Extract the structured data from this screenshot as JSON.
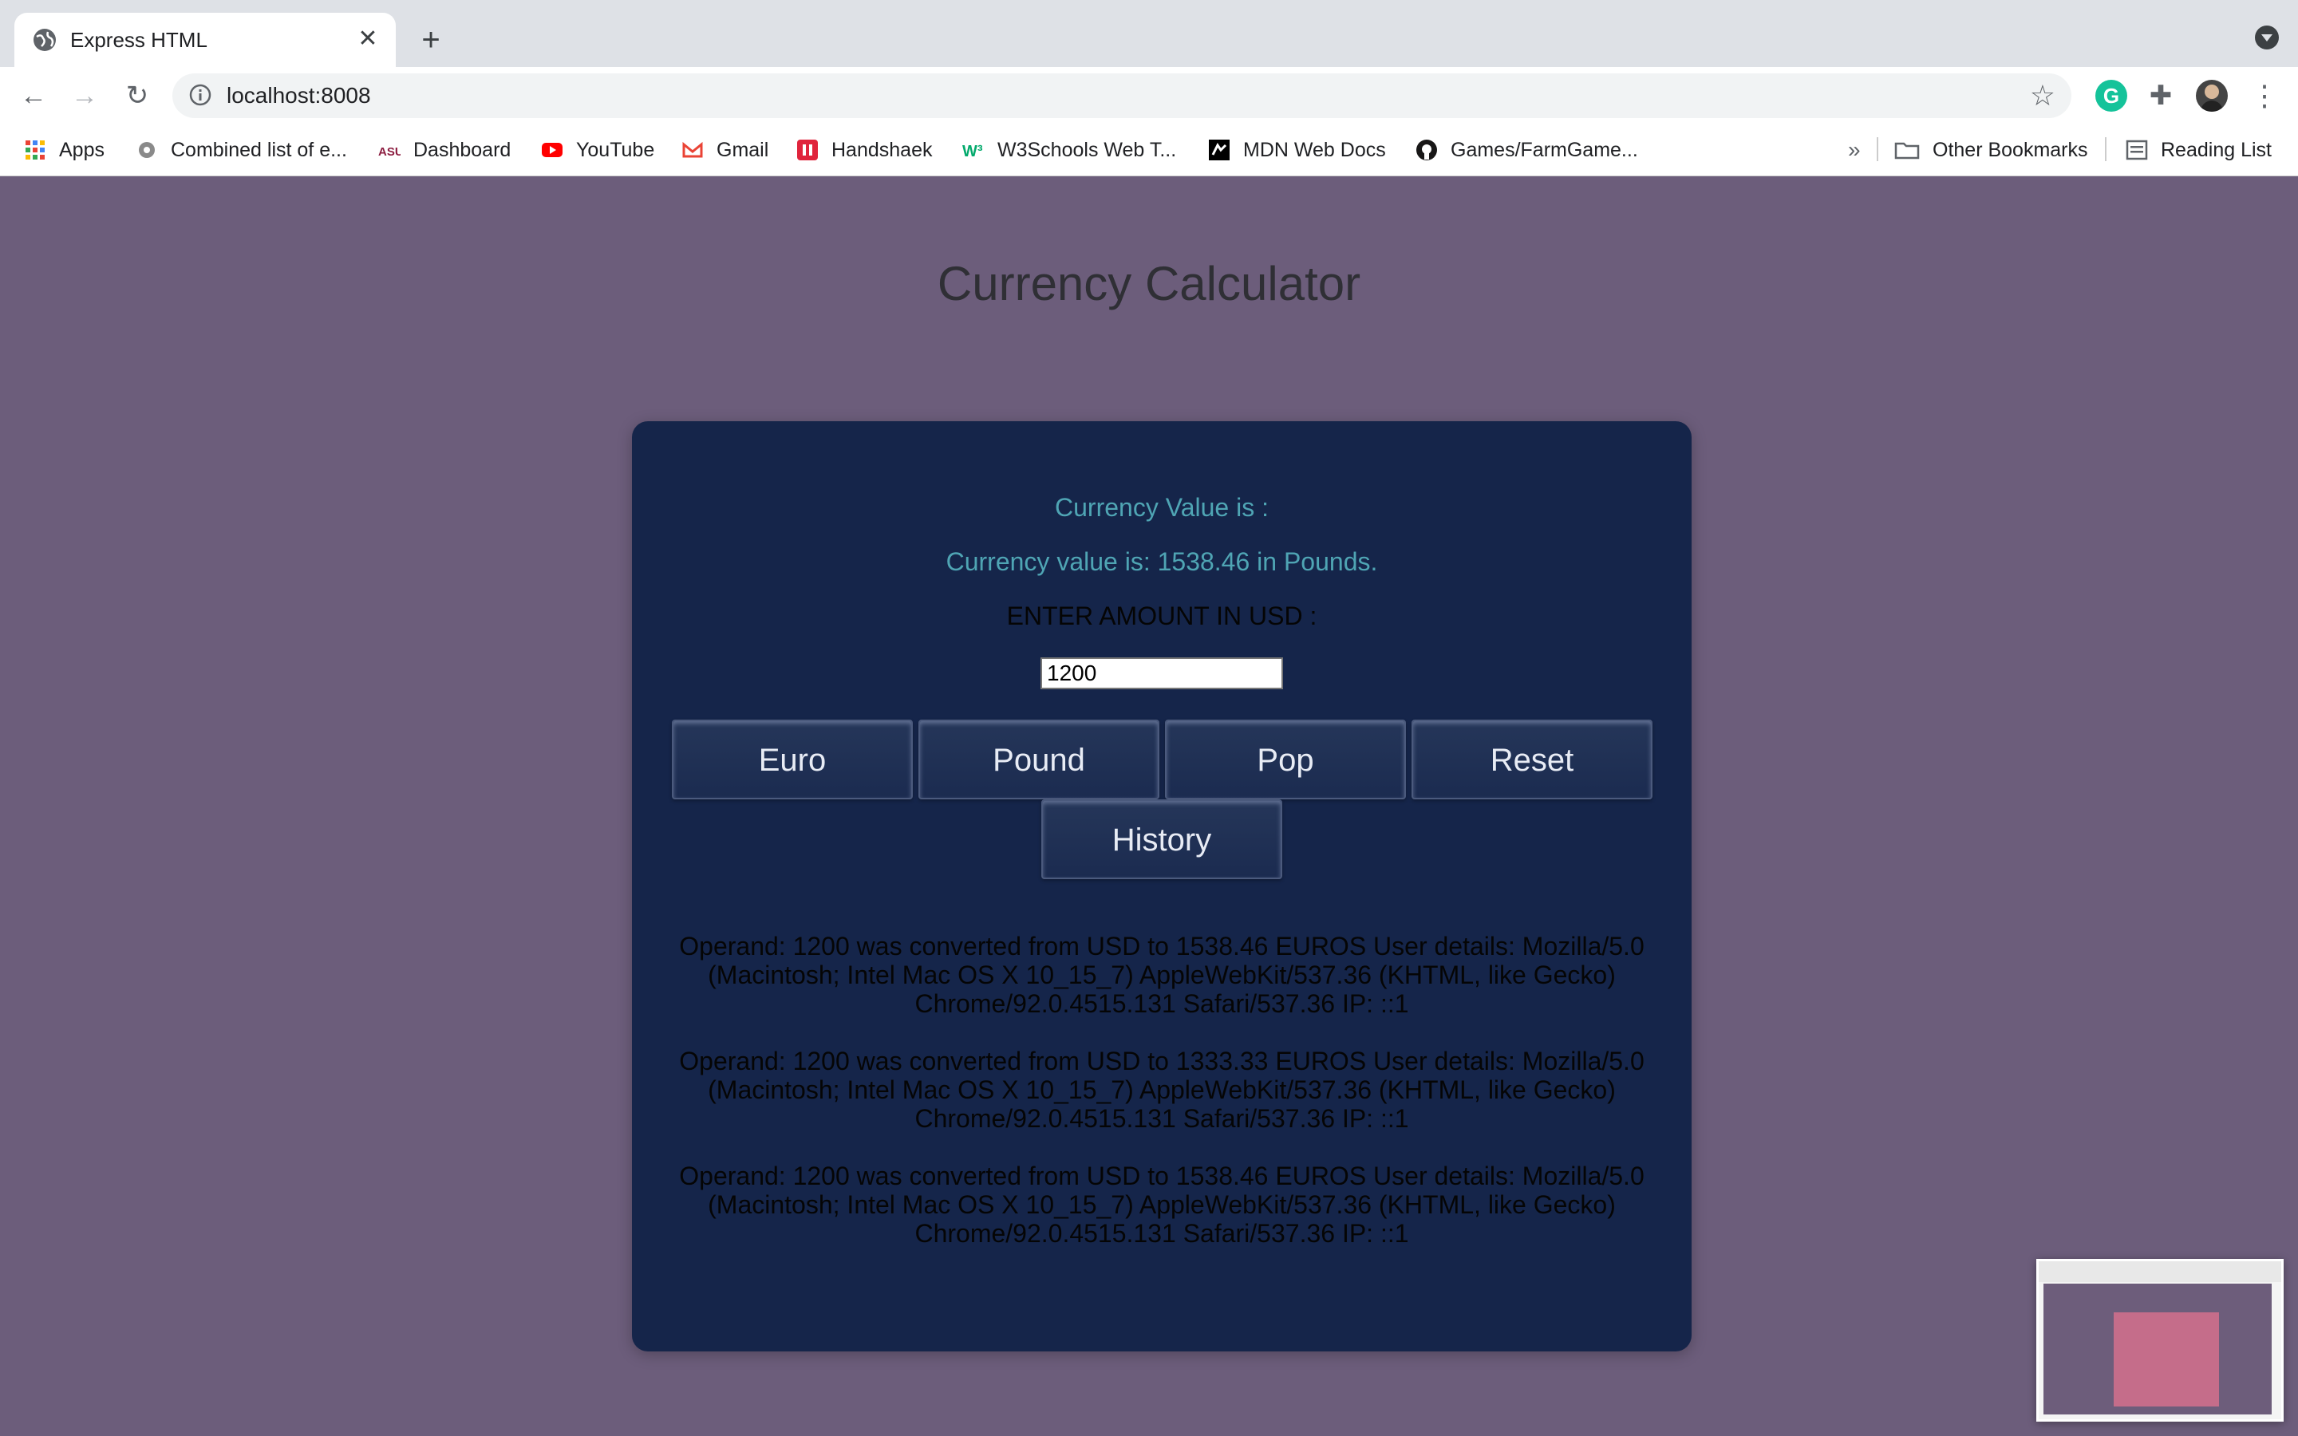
{
  "browser": {
    "tab_title": "Express HTML",
    "url": "localhost:8008",
    "bookmarks": [
      {
        "label": "Apps",
        "icon": "apps-grid-icon"
      },
      {
        "label": "Combined list of e...",
        "icon": "bookmark-icon"
      },
      {
        "label": "Dashboard",
        "icon": "asu-icon"
      },
      {
        "label": "YouTube",
        "icon": "youtube-icon"
      },
      {
        "label": "Gmail",
        "icon": "gmail-icon"
      },
      {
        "label": "Handshaek",
        "icon": "handshake-icon"
      },
      {
        "label": "W3Schools Web T...",
        "icon": "w3schools-icon"
      },
      {
        "label": "MDN Web Docs",
        "icon": "mdn-icon"
      },
      {
        "label": "Games/FarmGame...",
        "icon": "github-icon"
      }
    ],
    "overflow_label": "»",
    "other_bookmarks": "Other Bookmarks",
    "reading_list": "Reading List",
    "extension_letter": "G"
  },
  "page": {
    "title": "Currency Calculator",
    "currency_label": "Currency Value is :",
    "currency_result": "Currency value is: 1538.46 in Pounds.",
    "enter_label": "ENTER AMOUNT IN USD :",
    "amount_value": "1200",
    "buttons": {
      "euro": "Euro",
      "pound": "Pound",
      "pop": "Pop",
      "reset": "Reset",
      "history": "History"
    },
    "history": [
      "Operand: 1200 was converted from USD to 1538.46 EUROS User details: Mozilla/5.0 (Macintosh; Intel Mac OS X 10_15_7) AppleWebKit/537.36 (KHTML, like Gecko) Chrome/92.0.4515.131 Safari/537.36 IP: ::1",
      "Operand: 1200 was converted from USD to 1333.33 EUROS User details: Mozilla/5.0 (Macintosh; Intel Mac OS X 10_15_7) AppleWebKit/537.36 (KHTML, like Gecko) Chrome/92.0.4515.131 Safari/537.36 IP: ::1",
      "Operand: 1200 was converted from USD to 1538.46 EUROS User details: Mozilla/5.0 (Macintosh; Intel Mac OS X 10_15_7) AppleWebKit/537.36 (KHTML, like Gecko) Chrome/92.0.4515.131 Safari/537.36 IP: ::1"
    ]
  },
  "colors": {
    "page_bg": "#6c5d7b",
    "card_bg": "#15254a",
    "teal_text": "#4fa5b4"
  }
}
